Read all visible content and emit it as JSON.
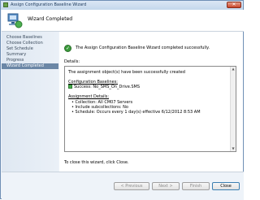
{
  "window": {
    "title": "Assign Configuration Baseline Wizard",
    "close_glyph": "✕"
  },
  "header": {
    "page_title": "Wizard Completed",
    "icon": "wizard-computer-icon"
  },
  "nav": {
    "items": [
      {
        "label": "Choose Baselines",
        "active": false
      },
      {
        "label": "Choose Collection",
        "active": false
      },
      {
        "label": "Set Schedule",
        "active": false
      },
      {
        "label": "Summary",
        "active": false
      },
      {
        "label": "Progress",
        "active": false
      },
      {
        "label": "Wizard Completed",
        "active": true
      }
    ]
  },
  "main": {
    "status_text": "The Assign Configuration Baseline Wizard completed successfully.",
    "status_icon": "success-check-icon",
    "details_label": "Details:",
    "details": {
      "line1": "The assignment object(s) have been successfully created",
      "baselines_heading": "Configuration Baselines:",
      "baseline_item": "Success: No_SMS_On_Drive.SMS",
      "assignment_heading": "Assignment Details:",
      "assignment_items": [
        "• Collection: All CM07 Servers",
        "• Include subcollections: No",
        "• Schedule: Occurs every 1 day(s) effective 6/12/2012 8:53 AM"
      ]
    },
    "close_hint": "To close this wizard, click Close."
  },
  "footer": {
    "previous_label": "< Previous",
    "next_label": "Next >",
    "finish_label": "Finish",
    "close_label": "Close"
  },
  "colors": {
    "accent": "#6b87a6",
    "success": "#3c9b3c"
  }
}
